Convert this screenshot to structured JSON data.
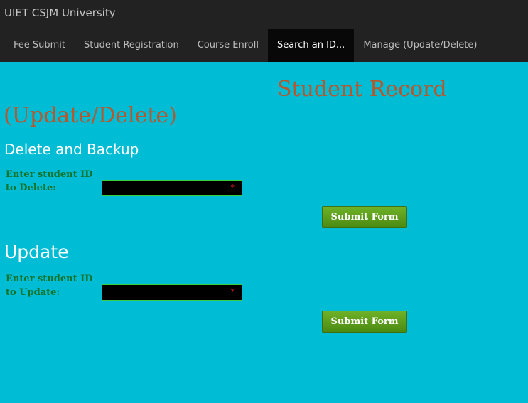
{
  "header": {
    "brand": "UIET CSJM University",
    "nav": [
      {
        "label": "Fee Submit"
      },
      {
        "label": "Student Registration"
      },
      {
        "label": "Course Enroll"
      },
      {
        "label": "Search an ID..."
      },
      {
        "label": "Manage (Update/Delete)"
      }
    ],
    "active_nav": "Search an ID..."
  },
  "page": {
    "title_line1": "Student Record",
    "title_line2": "(Update/Delete)"
  },
  "delete_section": {
    "heading": "Delete and Backup",
    "label": "Enter student ID to Delete:",
    "value": "",
    "required_mark": "*",
    "button": "Submit Form"
  },
  "update_section": {
    "heading": "Update",
    "label": "Enter student ID to Update:",
    "value": "",
    "required_mark": "*",
    "button": "Submit Form"
  },
  "colors": {
    "background": "#00bcd4",
    "navbar": "#222222",
    "title": "#b5582e",
    "label": "#15732a",
    "button": "#5c9e1c"
  }
}
